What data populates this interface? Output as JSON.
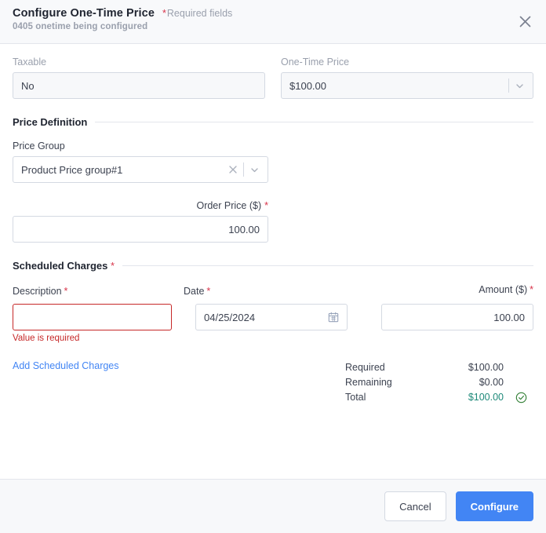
{
  "header": {
    "title": "Configure One-Time Price",
    "required_note": "Required fields",
    "asterisk": "*",
    "subtitle": "0405 onetime being configured",
    "close_icon": "close-icon"
  },
  "top_fields": {
    "taxable": {
      "label": "Taxable",
      "value": "No"
    },
    "one_time_price": {
      "label": "One-Time Price",
      "value": "$100.00"
    }
  },
  "price_definition": {
    "section_title": "Price Definition",
    "price_group": {
      "label": "Price Group",
      "value": "Product Price group#1"
    },
    "order_price": {
      "label": "Order Price ($)",
      "asterisk": "*",
      "value": "100.00"
    }
  },
  "scheduled_charges": {
    "section_title": "Scheduled Charges",
    "asterisk": "*",
    "columns": {
      "description": "Description",
      "date": "Date",
      "amount": "Amount ($)"
    },
    "row": {
      "description_value": "",
      "description_error": "Value is required",
      "date_value": "04/25/2024",
      "amount_value": "100.00"
    },
    "add_link": "Add Scheduled Charges"
  },
  "totals": [
    {
      "label": "Required",
      "value": "$100.00"
    },
    {
      "label": "Remaining",
      "value": "$0.00"
    },
    {
      "label": "Total",
      "value": "$100.00"
    }
  ],
  "footer": {
    "cancel_label": "Cancel",
    "configure_label": "Configure"
  },
  "colors": {
    "accent": "#4285f4",
    "error": "#c62828",
    "required_asterisk": "#d8344a",
    "total": "#1f8a7a",
    "success": "#2e7d32"
  }
}
